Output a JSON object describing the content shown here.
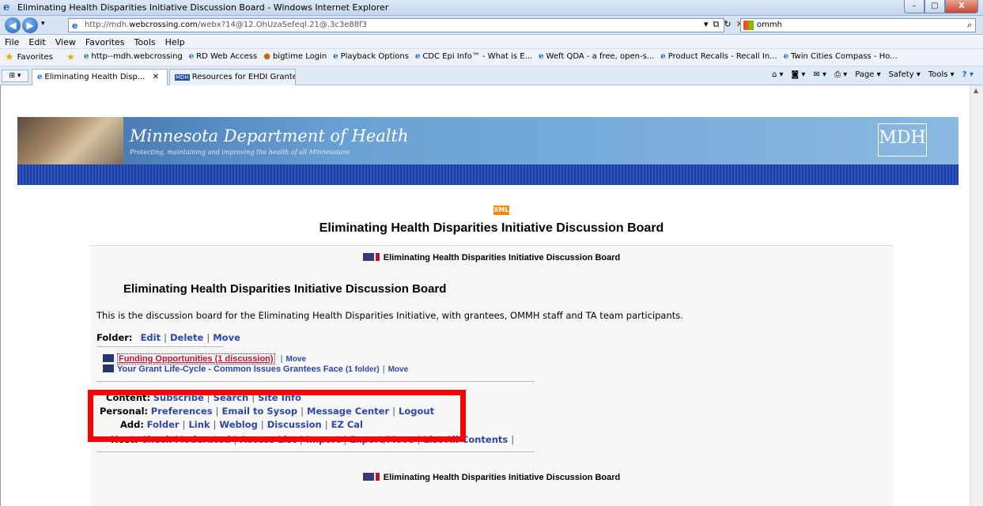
{
  "window": {
    "title": "Eliminating Health Disparities Initiative Discussion Board - Windows Internet Explorer",
    "controls": [
      "–",
      "▢",
      "X"
    ]
  },
  "address": {
    "url_prefix": "http://mdh.",
    "url_host": "webcrossing.com",
    "url_path": "/webx?14@12.OhUzaSefeql.21@.3c3e88f3",
    "search_value": "ommh"
  },
  "menu": [
    "File",
    "Edit",
    "View",
    "Favorites",
    "Tools",
    "Help"
  ],
  "favorites": {
    "label": "Favorites",
    "links": [
      "http--mdh.webcrossing",
      "RD Web Access",
      "bigtime Login",
      "Playback Options",
      "CDC Epi Info™ - What is E...",
      "Weft QDA - a free, open-s...",
      "Product Recalls - Recall In...",
      "Twin Cities Compass - Ho..."
    ]
  },
  "tabs": {
    "active": "Eliminating Health Disp...",
    "inactive": "Resources for EHDI Grante...",
    "commands": [
      "Page ▾",
      "Safety ▾",
      "Tools ▾"
    ]
  },
  "banner": {
    "title": "Minnesota Department of Health",
    "tagline": "Protecting, maintaining and improving the health of all Minnesotans",
    "logo": "MDH"
  },
  "page": {
    "xml_badge": "XML",
    "title": "Eliminating Health Disparities Initiative Discussion Board",
    "breadcrumb": "Eliminating Health Disparities Initiative Discussion Board",
    "heading": "Eliminating Health Disparities Initiative Discussion Board",
    "description": "This is the discussion board for the Eliminating Health Disparities Initiative, with grantees, OMMH staff and TA team participants.",
    "folder_label": "Folder:",
    "folder_actions": [
      "Edit",
      "Delete",
      "Move"
    ]
  },
  "items": [
    {
      "title": "Funding Opportunities (1 discussion)",
      "action": "Move"
    },
    {
      "title": "Your Grant Life-Cycle - Common Issues Grantees Face",
      "count": "(1 folder)",
      "action": "Move"
    }
  ],
  "content_row": {
    "label": "Content:",
    "links": [
      "Subscribe",
      "Search",
      "Site Info"
    ]
  },
  "personal_row": {
    "label": "Personal:",
    "links": [
      "Preferences",
      "Email to Sysop",
      "Message Center",
      "Logout"
    ]
  },
  "add_row": {
    "label": "Add:",
    "links": [
      "Folder",
      "Link",
      "Weblog",
      "Discussion",
      "EZ Cal"
    ]
  },
  "host_row": {
    "label": "Host:",
    "links": [
      "Check Moderated",
      "Access List",
      "Import",
      "Export/Move",
      "List All Contents"
    ]
  },
  "colors": {
    "highlight_box": "#ff0000",
    "link": "#2b47a8",
    "banner_blue": "#2e56c2"
  }
}
